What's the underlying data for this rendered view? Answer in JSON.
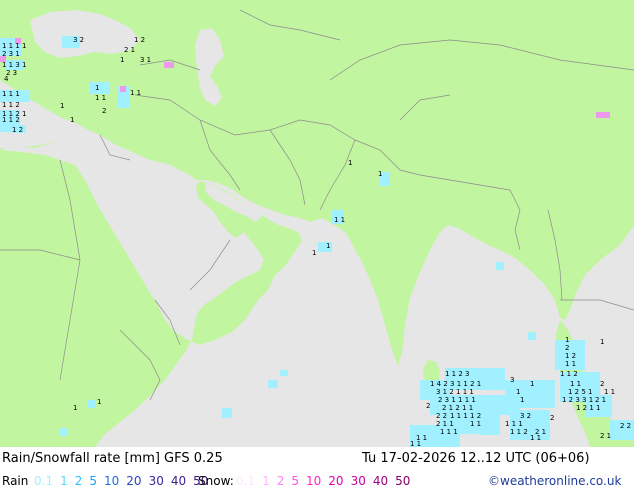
{
  "map": {
    "colors": {
      "land": "#c2f5a0",
      "sea": "#e6e6e6",
      "border": "#8c8c8c",
      "coast": "#8c8c8c"
    },
    "precip_color": "#a0f0ff",
    "pink_color": "#ee99ee",
    "value_labels": {
      "mediterranean": [
        "3",
        "2",
        "1 2",
        "1 1 1 1",
        "2 3 1",
        "1 1 2 1",
        "2 3",
        "1 1 3 1",
        "4",
        "2 1",
        "1 1 2",
        "1 1",
        "1"
      ],
      "bay_of_bengal": [
        "1 1 2 1",
        "1 4 2 3 1 1 2 1",
        "2 3 1 1 1 1",
        "3 1 2 1 1 1",
        "2 1 2 1 1",
        "1 1 1 1 2",
        "2 1 1",
        "1 1 2",
        "2 2",
        "1 1"
      ],
      "south_asia": [
        "1",
        "1",
        "1 1",
        "1 1",
        "1",
        "1"
      ]
    }
  },
  "footer": {
    "title": "Rain/Snowfall rate [mm] GFS 0.25",
    "datetime": "Tu 17-02-2026 12..12 UTC (06+06)",
    "rain_label": "Rain",
    "rain_levels": [
      {
        "v": "0.1",
        "c": "#a0f0ff"
      },
      {
        "v": "1",
        "c": "#60d7ff"
      },
      {
        "v": "2",
        "c": "#2ec4ff"
      },
      {
        "v": "5",
        "c": "#1ea0f0"
      },
      {
        "v": "10",
        "c": "#1e6ee6"
      },
      {
        "v": "20",
        "c": "#2846c8"
      },
      {
        "v": "30",
        "c": "#3228a0"
      },
      {
        "v": "40",
        "c": "#3c1e8c"
      },
      {
        "v": "50",
        "c": "#3c1478"
      }
    ],
    "snow_label": "Snow:",
    "snow_levels": [
      {
        "v": "0.1",
        "c": "#ffe6ff"
      },
      {
        "v": "1",
        "c": "#ffb4ff"
      },
      {
        "v": "2",
        "c": "#ff82ff"
      },
      {
        "v": "5",
        "c": "#ff50e6"
      },
      {
        "v": "10",
        "c": "#ff28c8"
      },
      {
        "v": "20",
        "c": "#e600b4"
      },
      {
        "v": "30",
        "c": "#c800a0"
      },
      {
        "v": "40",
        "c": "#a00082"
      },
      {
        "v": "50",
        "c": "#820064"
      }
    ],
    "credit": "©weatheronline.co.uk"
  }
}
